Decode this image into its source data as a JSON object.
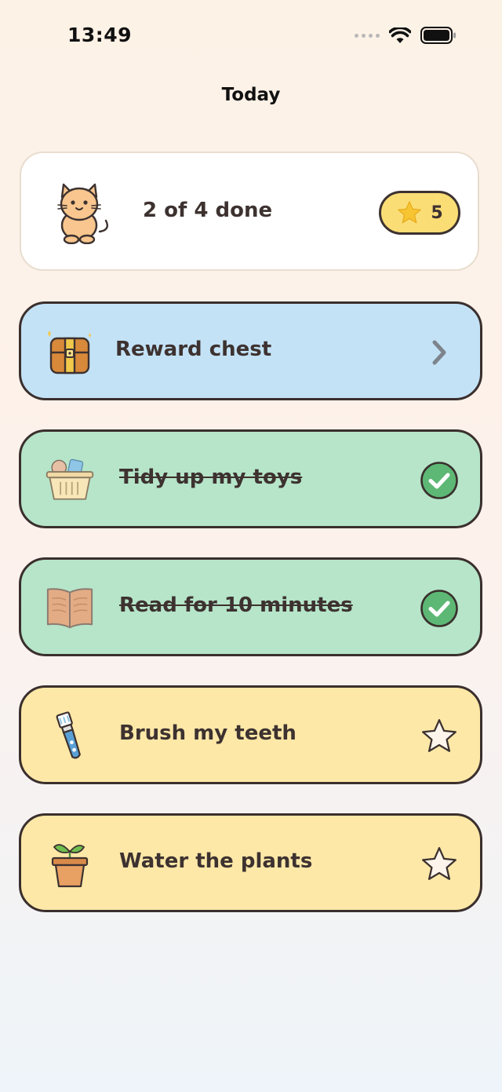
{
  "status_bar": {
    "time": "13:49"
  },
  "nav": {
    "title": "Today"
  },
  "summary": {
    "progress_text": "2 of 4 done",
    "star_count": "5",
    "done": 2,
    "total": 4
  },
  "reward": {
    "label": "Reward chest"
  },
  "tasks": [
    {
      "label": "Tidy up my toys",
      "completed": true,
      "icon": "toy-basket-icon"
    },
    {
      "label": "Read for 10 minutes",
      "completed": true,
      "icon": "open-book-icon"
    },
    {
      "label": "Brush my teeth",
      "completed": false,
      "icon": "toothbrush-icon"
    },
    {
      "label": "Water the plants",
      "completed": false,
      "icon": "potted-plant-icon"
    }
  ],
  "colors": {
    "reward_card": "#c3e2f6",
    "done_card": "#b6e5c9",
    "todo_card": "#fde8a7",
    "check_green": "#5cb874",
    "star_pill": "#fbdd76",
    "outline": "#3a2f2d"
  }
}
